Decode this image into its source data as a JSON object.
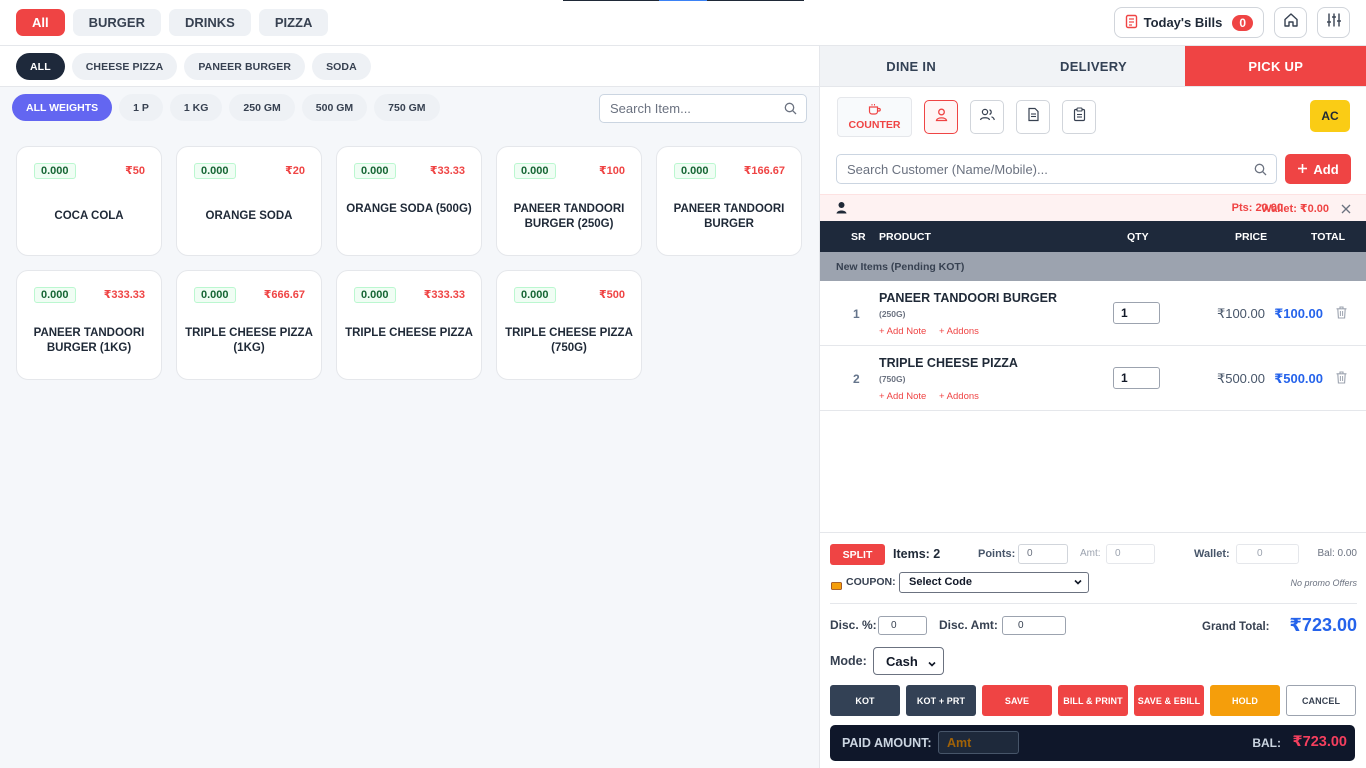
{
  "categories": [
    {
      "label": "All",
      "active": true
    },
    {
      "label": "BURGER",
      "active": false
    },
    {
      "label": "DRINKS",
      "active": false
    },
    {
      "label": "PIZZA",
      "active": false
    }
  ],
  "header": {
    "todays_bills_label": "Today's Bills",
    "todays_bills_count": "0",
    "home_icon": "home-icon",
    "settings_icon": "sliders-icon"
  },
  "subcategories": [
    {
      "label": "ALL",
      "active": true
    },
    {
      "label": "CHEESE PIZZA",
      "active": false
    },
    {
      "label": "PANEER BURGER",
      "active": false
    },
    {
      "label": "SODA",
      "active": false
    }
  ],
  "weights": [
    {
      "label": "ALL WEIGHTS",
      "active": true
    },
    {
      "label": "1 P",
      "active": false
    },
    {
      "label": "1 KG",
      "active": false
    },
    {
      "label": "250 GM",
      "active": false
    },
    {
      "label": "500 GM",
      "active": false
    },
    {
      "label": "750 GM",
      "active": false
    }
  ],
  "item_search": {
    "placeholder": "Search Item..."
  },
  "items": [
    {
      "qty": "0.000",
      "price": "₹50",
      "name": "COCA COLA"
    },
    {
      "qty": "0.000",
      "price": "₹20",
      "name": "ORANGE SODA"
    },
    {
      "qty": "0.000",
      "price": "₹33.33",
      "name": "ORANGE SODA (500G)"
    },
    {
      "qty": "0.000",
      "price": "₹100",
      "name": "PANEER TANDOORI BURGER (250G)"
    },
    {
      "qty": "0.000",
      "price": "₹166.67",
      "name": "PANEER TANDOORI BURGER"
    },
    {
      "qty": "0.000",
      "price": "₹333.33",
      "name": "PANEER TANDOORI BURGER (1KG)"
    },
    {
      "qty": "0.000",
      "price": "₹666.67",
      "name": "TRIPLE CHEESE PIZZA (1KG)"
    },
    {
      "qty": "0.000",
      "price": "₹333.33",
      "name": "TRIPLE CHEESE PIZZA"
    },
    {
      "qty": "0.000",
      "price": "₹500",
      "name": "TRIPLE CHEESE PIZZA (750G)"
    }
  ],
  "order_tabs": [
    {
      "label": "DINE IN",
      "active": false
    },
    {
      "label": "DELIVERY",
      "active": false
    },
    {
      "label": "PICK UP",
      "active": true
    }
  ],
  "customer": {
    "counter_label": "COUNTER",
    "ac_label": "AC",
    "search_placeholder": "Search Customer (Name/Mobile)...",
    "add_label": "Add",
    "points_text": "Pts: 20.00",
    "wallet_text": "Wallet: ₹0.00"
  },
  "table": {
    "headers": {
      "sr": "SR",
      "product": "PRODUCT",
      "qty": "QTY",
      "price": "PRICE",
      "total": "TOTAL"
    },
    "pending_label": "New Items (Pending KOT)",
    "add_note_label": "+ Add Note",
    "addons_label": "+ Addons",
    "rows": [
      {
        "sr": "1",
        "name": "PANEER TANDOORI BURGER",
        "variant": "(250G)",
        "qty": "1",
        "price": "₹100.00",
        "total": "₹100.00"
      },
      {
        "sr": "2",
        "name": "TRIPLE CHEESE PIZZA",
        "variant": "(750G)",
        "qty": "1",
        "price": "₹500.00",
        "total": "₹500.00"
      }
    ]
  },
  "summary": {
    "split_label": "SPLIT",
    "items_label": "Items: 2",
    "points_label": "Points:",
    "points_value": "0",
    "amt_label": "Amt:",
    "amt_value": "0",
    "wallet_label": "Wallet:",
    "wallet_value": "0",
    "bal_label": "Bal: 0.00",
    "coupon_label": "COUPON:",
    "coupon_selected": "Select Code",
    "no_promo": "No promo Offers",
    "disc_pct_label": "Disc. %:",
    "disc_pct_value": "0",
    "disc_amt_label": "Disc. Amt:",
    "disc_amt_value": "0",
    "grand_total_label": "Grand Total:",
    "grand_total_value": "₹723.00",
    "mode_label": "Mode:",
    "mode_selected": "Cash"
  },
  "actions": {
    "kot": "KOT",
    "kot_prt": "KOT + PRT",
    "save": "SAVE",
    "bill_print": "BILL & PRINT",
    "save_ebill": "SAVE & EBILL",
    "hold": "HOLD",
    "cancel": "CANCEL"
  },
  "payment": {
    "paid_label": "PAID AMOUNT:",
    "amt_placeholder": "Amt",
    "bal_label": "BAL:",
    "bal_value": "₹723.00"
  },
  "colors": {
    "accent_red": "#ef4444",
    "active_indigo": "#6366f1",
    "dark": "#1e293b",
    "total_blue": "#2563eb",
    "ac_yellow": "#facc15",
    "hold_orange": "#f59e0b"
  }
}
